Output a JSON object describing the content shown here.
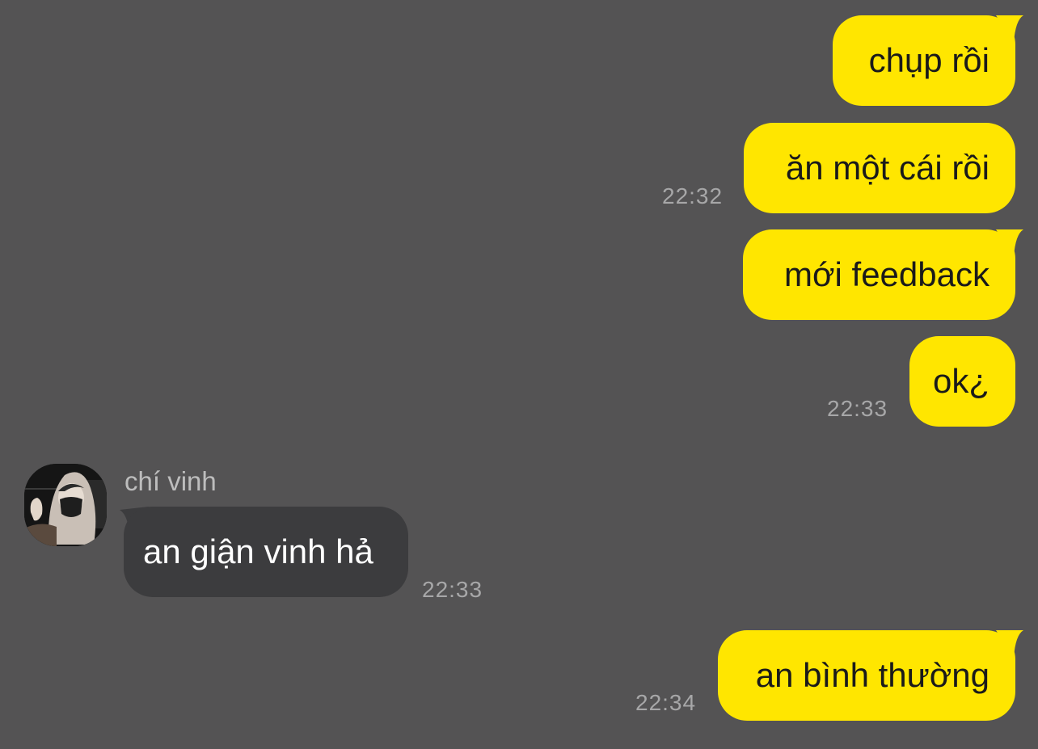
{
  "colors": {
    "background": "#545354",
    "outgoing_bubble": "#ffe600",
    "incoming_bubble": "#3c3c3e",
    "timestamp": "#a7a7a8"
  },
  "messages": [
    {
      "id": "m1",
      "direction": "outgoing",
      "text": "chụp rồi",
      "time": ""
    },
    {
      "id": "m2",
      "direction": "outgoing",
      "text": "ăn một cái rồi",
      "time": "22:32"
    },
    {
      "id": "m3",
      "direction": "outgoing",
      "text": "mới feedback",
      "time": ""
    },
    {
      "id": "m4",
      "direction": "outgoing",
      "text": "ok¿",
      "time": "22:33"
    },
    {
      "id": "m5",
      "direction": "incoming",
      "sender": "chí vinh",
      "avatar_icon": "user-avatar-photo",
      "text": "an giận vinh hả",
      "time": "22:33"
    },
    {
      "id": "m6",
      "direction": "outgoing",
      "text": "an bình thường",
      "time": "22:34"
    }
  ]
}
